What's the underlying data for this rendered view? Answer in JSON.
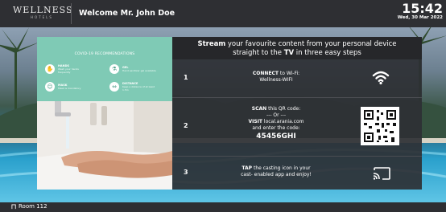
{
  "header": {
    "logo_main": "WELLNESS",
    "logo_sub": "HOTELS",
    "welcome": "Welcome Mr. John Doe",
    "time": "15:42",
    "date": "Wed, 30 Mar 2022"
  },
  "covid": {
    "title": "COVID-19 RECOMMENDATIONS",
    "items": [
      {
        "label": "HANDS",
        "desc": "Wash your hands frequently",
        "icon": "hand-wash-icon"
      },
      {
        "label": "GEL",
        "desc": "Hand sanitizer gel available",
        "icon": "gel-bottle-icon"
      },
      {
        "label": "MASK",
        "desc": "Mask is mandatory",
        "icon": "face-mask-icon"
      },
      {
        "label": "DISTANCE",
        "desc": "Keep a distance of at least 1.5m",
        "icon": "distance-icon"
      }
    ]
  },
  "cast": {
    "headline_strong1": "Stream",
    "headline_rest1": " your favourite content from your personal device",
    "headline_pre2": "straight to the ",
    "headline_strong2": "TV",
    "headline_rest2": " in three easy steps",
    "steps": [
      {
        "num": "1",
        "strong": "CONNECT",
        "text": " to Wi-Fi:",
        "line2": "Wellness-WIFI",
        "icon": "wifi-icon"
      },
      {
        "num": "2",
        "strong": "SCAN",
        "text": " this QR code:",
        "or": "--- Or ---",
        "visit_strong": "VISIT",
        "visit_text": " local.arania.com",
        "enter": "and enter the code:",
        "code": "45456GHI",
        "icon": "qr-code-icon"
      },
      {
        "num": "3",
        "strong": "TAP",
        "text": " the casting icon in your",
        "line2": "cast- enabled app and enjoy!",
        "icon": "cast-icon"
      }
    ]
  },
  "footer": {
    "room": "Room 112"
  },
  "colors": {
    "bar": "#2e2f33",
    "panel": "#303236",
    "covid_green": "#7fcab5"
  }
}
